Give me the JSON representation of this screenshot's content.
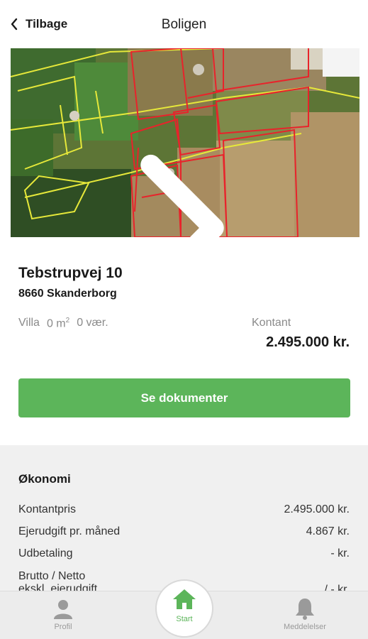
{
  "header": {
    "back_label": "Tilbage",
    "title": "Boligen"
  },
  "map": {
    "image": "aerial-property-map",
    "boundary_colors": [
      "#e8232b",
      "#e6e83a"
    ]
  },
  "property": {
    "street": "Tebstrupvej 10",
    "city": "8660 Skanderborg",
    "type": "Villa",
    "area": "0 m",
    "area_sup": "2",
    "rooms": "0 vær.",
    "price_label": "Kontant",
    "price": "2.495.000 kr."
  },
  "actions": {
    "documents_label": "Se dokumenter"
  },
  "economy": {
    "title": "Økonomi",
    "rows": [
      {
        "label": "Kontantpris",
        "value": "2.495.000 kr."
      },
      {
        "label": "Ejerudgift pr. måned",
        "value": "4.867 kr."
      },
      {
        "label": "Udbetaling",
        "value": "- kr."
      },
      {
        "label": "Brutto / Netto",
        "value": "/ - kr."
      }
    ],
    "row4_line2": "ekskl. ejerudgift"
  },
  "tabbar": {
    "profile": "Profil",
    "start": "Start",
    "messages": "Meddelelser"
  },
  "colors": {
    "accent": "#5cb55a",
    "muted": "#8a8a8a"
  }
}
